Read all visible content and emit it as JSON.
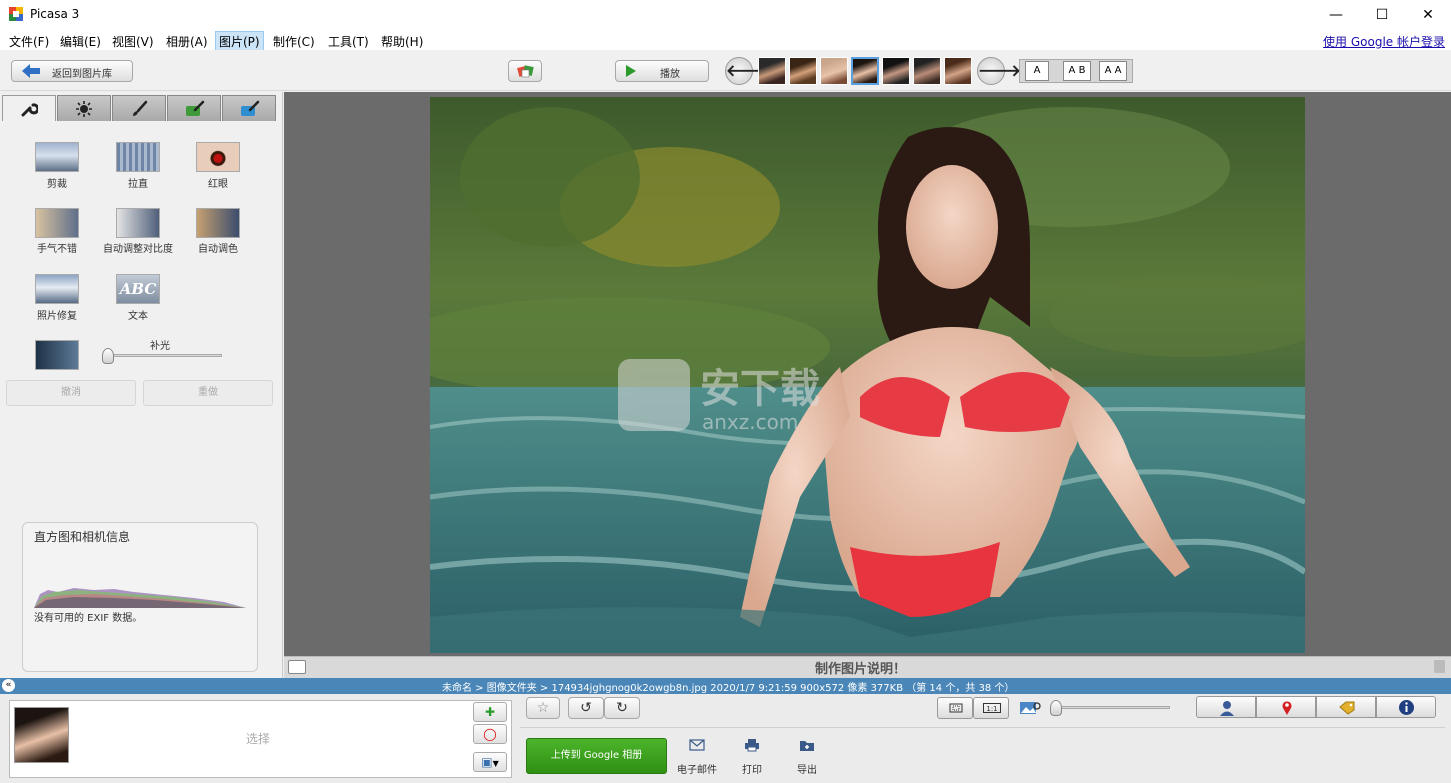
{
  "window": {
    "title": "Picasa 3",
    "controls": {
      "minimize": "—",
      "maximize": "☐",
      "close": "✕"
    }
  },
  "menu": {
    "items": [
      "文件(F)",
      "编辑(E)",
      "视图(V)",
      "相册(A)",
      "图片(P)",
      "制作(C)",
      "工具(T)",
      "帮助(H)"
    ],
    "active_index": 4,
    "signin_link": "使用 Google 帐户登录"
  },
  "toolbar": {
    "back_label": "返回到图片库",
    "play_label": "播放",
    "prev_icon": "arrow-left-icon",
    "next_icon": "arrow-right-icon",
    "view_modes": [
      "A",
      "A B",
      "A A"
    ]
  },
  "edit_panel": {
    "tabs": [
      "wrench-icon",
      "sun-icon",
      "brush-icon",
      "green-brush-icon",
      "blue-brush-icon"
    ],
    "tools": [
      {
        "label": "剪裁"
      },
      {
        "label": "拉直"
      },
      {
        "label": "红眼"
      },
      {
        "label": "手气不错"
      },
      {
        "label": "自动调整对比度"
      },
      {
        "label": "自动调色"
      },
      {
        "label": "照片修复"
      },
      {
        "label": "文本",
        "thumb_text": "ABC"
      }
    ],
    "fill_light_label": "补光",
    "undo_label": "撤消",
    "redo_label": "重做",
    "histogram_title": "直方图和相机信息",
    "exif_note": "没有可用的 EXIF 数据。"
  },
  "viewer": {
    "caption_prompt": "制作图片说明！",
    "watermark": "安下载 anxz.com"
  },
  "status": {
    "text": "未命名 > 图像文件夹 > 174934jghgnog0k2owgb8n.jpg    2020/1/7 9:21:59    900x572 像素    377KB    （第 14 个，共 38 个）"
  },
  "tray": {
    "label": "选择"
  },
  "actions": {
    "upload_label": "上传到 Google 相册",
    "email_label": "电子邮件",
    "print_label": "打印",
    "export_label": "导出"
  },
  "colors": {
    "status_bar": "#4a87b8",
    "upload_green": "#3a9e1c",
    "accent_blue": "#1a0dab"
  }
}
